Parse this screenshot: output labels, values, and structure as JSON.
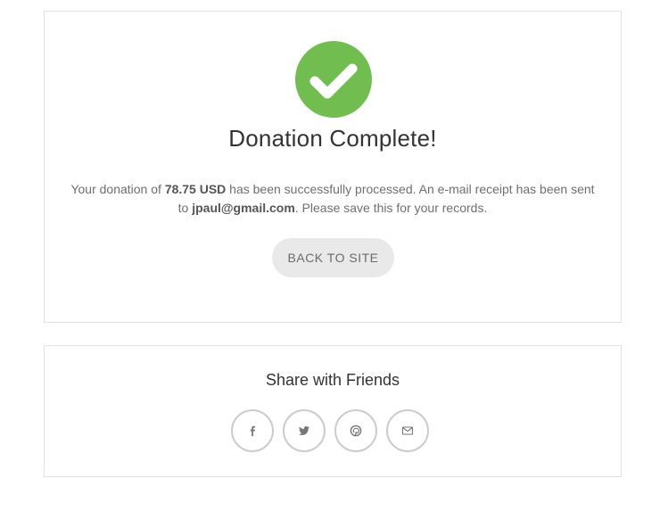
{
  "complete": {
    "title": "Donation Complete!",
    "message_prefix": "Your donation of ",
    "amount": "78.75 USD",
    "message_middle": " has been successfully processed. An e-mail receipt has been sent to ",
    "email": "jpaul@gmail.com",
    "message_suffix": ". Please save this for your records.",
    "back_button_label": "BACK TO SITE",
    "check_icon": "check-circle-icon",
    "accent_color": "#72bd50"
  },
  "share": {
    "title": "Share with Friends",
    "icons": [
      "facebook-icon",
      "twitter-icon",
      "pinterest-icon",
      "email-icon"
    ]
  }
}
